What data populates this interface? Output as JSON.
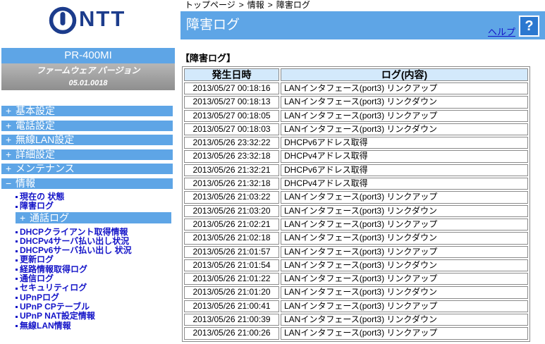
{
  "logo": {
    "brand": "NTT"
  },
  "sidebar": {
    "model": "PR-400MI",
    "firmware_label": "ファームウェア バージョン",
    "firmware_version": "05.01.0018",
    "menu": [
      {
        "prefix": "+",
        "label": "基本設定"
      },
      {
        "prefix": "+",
        "label": "電話設定"
      },
      {
        "prefix": "+",
        "label": "無線LAN設定"
      },
      {
        "prefix": "+",
        "label": "詳細設定"
      },
      {
        "prefix": "+",
        "label": "メンテナンス"
      },
      {
        "prefix": "−",
        "label": "情報"
      }
    ],
    "info_links_top": [
      "現在の 状態",
      "障害ログ"
    ],
    "info_submenu": {
      "prefix": "+",
      "label": "通話ログ"
    },
    "info_links_bottom": [
      "DHCPクライアント取得情報",
      "DHCPv4サーバ払い出し状況",
      "DHCPv6サーバ払い出し 状況",
      "更新ログ",
      "経路情報取得ログ",
      "通信ログ",
      "セキュリティログ",
      "UPnPログ",
      "UPnP CPテーブル",
      "UPnP NAT設定情報",
      "無線LAN情報"
    ]
  },
  "breadcrumb": {
    "items": [
      "トップページ",
      "情報",
      "障害ログ"
    ],
    "separator": ">"
  },
  "header": {
    "title": "障害ログ",
    "help_label": "ヘルプ",
    "help_icon_glyph": "?"
  },
  "section_title": "【障害ログ】",
  "log_table": {
    "columns": [
      "発生日時",
      "ログ(内容)"
    ],
    "rows": [
      {
        "time": "2013/05/27 00:18:16",
        "message": "LANインタフェース(port3) リンクアップ"
      },
      {
        "time": "2013/05/27 00:18:13",
        "message": "LANインタフェース(port3) リンクダウン"
      },
      {
        "time": "2013/05/27 00:18:05",
        "message": "LANインタフェース(port3) リンクアップ"
      },
      {
        "time": "2013/05/27 00:18:03",
        "message": "LANインタフェース(port3) リンクダウン"
      },
      {
        "time": "2013/05/26 23:32:22",
        "message": "DHCPv6アドレス取得"
      },
      {
        "time": "2013/05/26 23:32:18",
        "message": "DHCPv4アドレス取得"
      },
      {
        "time": "2013/05/26 21:32:21",
        "message": "DHCPv6アドレス取得"
      },
      {
        "time": "2013/05/26 21:32:18",
        "message": "DHCPv4アドレス取得"
      },
      {
        "time": "2013/05/26 21:03:22",
        "message": "LANインタフェース(port3) リンクアップ"
      },
      {
        "time": "2013/05/26 21:03:20",
        "message": "LANインタフェース(port3) リンクダウン"
      },
      {
        "time": "2013/05/26 21:02:21",
        "message": "LANインタフェース(port3) リンクアップ"
      },
      {
        "time": "2013/05/26 21:02:18",
        "message": "LANインタフェース(port3) リンクダウン"
      },
      {
        "time": "2013/05/26 21:01:57",
        "message": "LANインタフェース(port3) リンクアップ"
      },
      {
        "time": "2013/05/26 21:01:54",
        "message": "LANインタフェース(port3) リンクダウン"
      },
      {
        "time": "2013/05/26 21:01:22",
        "message": "LANインタフェース(port3) リンクアップ"
      },
      {
        "time": "2013/05/26 21:01:20",
        "message": "LANインタフェース(port3) リンクダウン"
      },
      {
        "time": "2013/05/26 21:00:41",
        "message": "LANインタフェース(port3) リンクアップ"
      },
      {
        "time": "2013/05/26 21:00:39",
        "message": "LANインタフェース(port3) リンクダウン"
      },
      {
        "time": "2013/05/26 21:00:26",
        "message": "LANインタフェース(port3) リンクアップ"
      }
    ]
  },
  "colors": {
    "accent": "#5ea5e6",
    "link": "#1414c8",
    "table_header_bg": "#d3e9fb",
    "table_border": "#8a8a8a",
    "firmware_top": "#b6b6b6",
    "firmware_bottom": "#8e8e8e",
    "logo": "#1c3c8c",
    "help_icon_bg": "#2b78d0"
  }
}
